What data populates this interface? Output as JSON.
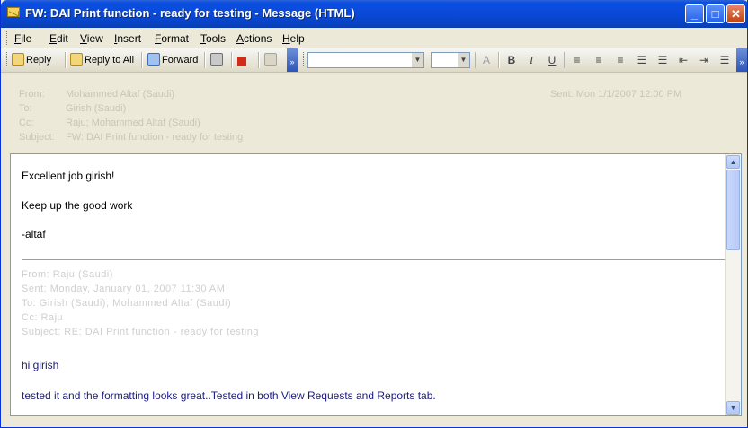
{
  "window": {
    "title": "FW: DAI Print function - ready for testing - Message (HTML)",
    "min_glyph": "_",
    "max_glyph": "□",
    "close_glyph": "✕"
  },
  "menu": [
    "File",
    "Edit",
    "View",
    "Insert",
    "Format",
    "Tools",
    "Actions",
    "Help"
  ],
  "toolbar": {
    "reply": "Reply",
    "reply_all": "Reply to All",
    "forward": "Forward",
    "bold": "B",
    "italic": "I",
    "underline": "U",
    "font_color": "A",
    "chevron": "»"
  },
  "header": {
    "from_label": "From:",
    "from_value": "Mohammed Altaf (Saudi)",
    "to_label": "To:",
    "to_value": "Girish (Saudi)",
    "cc_label": "Cc:",
    "cc_value": "Raju; Mohammed Altaf (Saudi)",
    "subject_label": "Subject:",
    "subject_value": "FW: DAI Print function - ready for testing",
    "sent": "Sent: Mon 1/1/2007 12:00 PM"
  },
  "body": {
    "line1": "Excellent job girish!",
    "line2": "Keep up the good work",
    "line3": "-altaf",
    "quoted_from": "From: Raju (Saudi)",
    "quoted_sent": "Sent: Monday, January 01, 2007 11:30 AM",
    "quoted_to": "To: Girish (Saudi); Mohammed Altaf (Saudi)",
    "quoted_cc": "Cc: Raju",
    "quoted_subject": "Subject: RE: DAI Print function - ready for testing",
    "greeting": "hi girish",
    "text": "tested it and the formatting looks great..Tested in both View Requests and Reports tab."
  }
}
